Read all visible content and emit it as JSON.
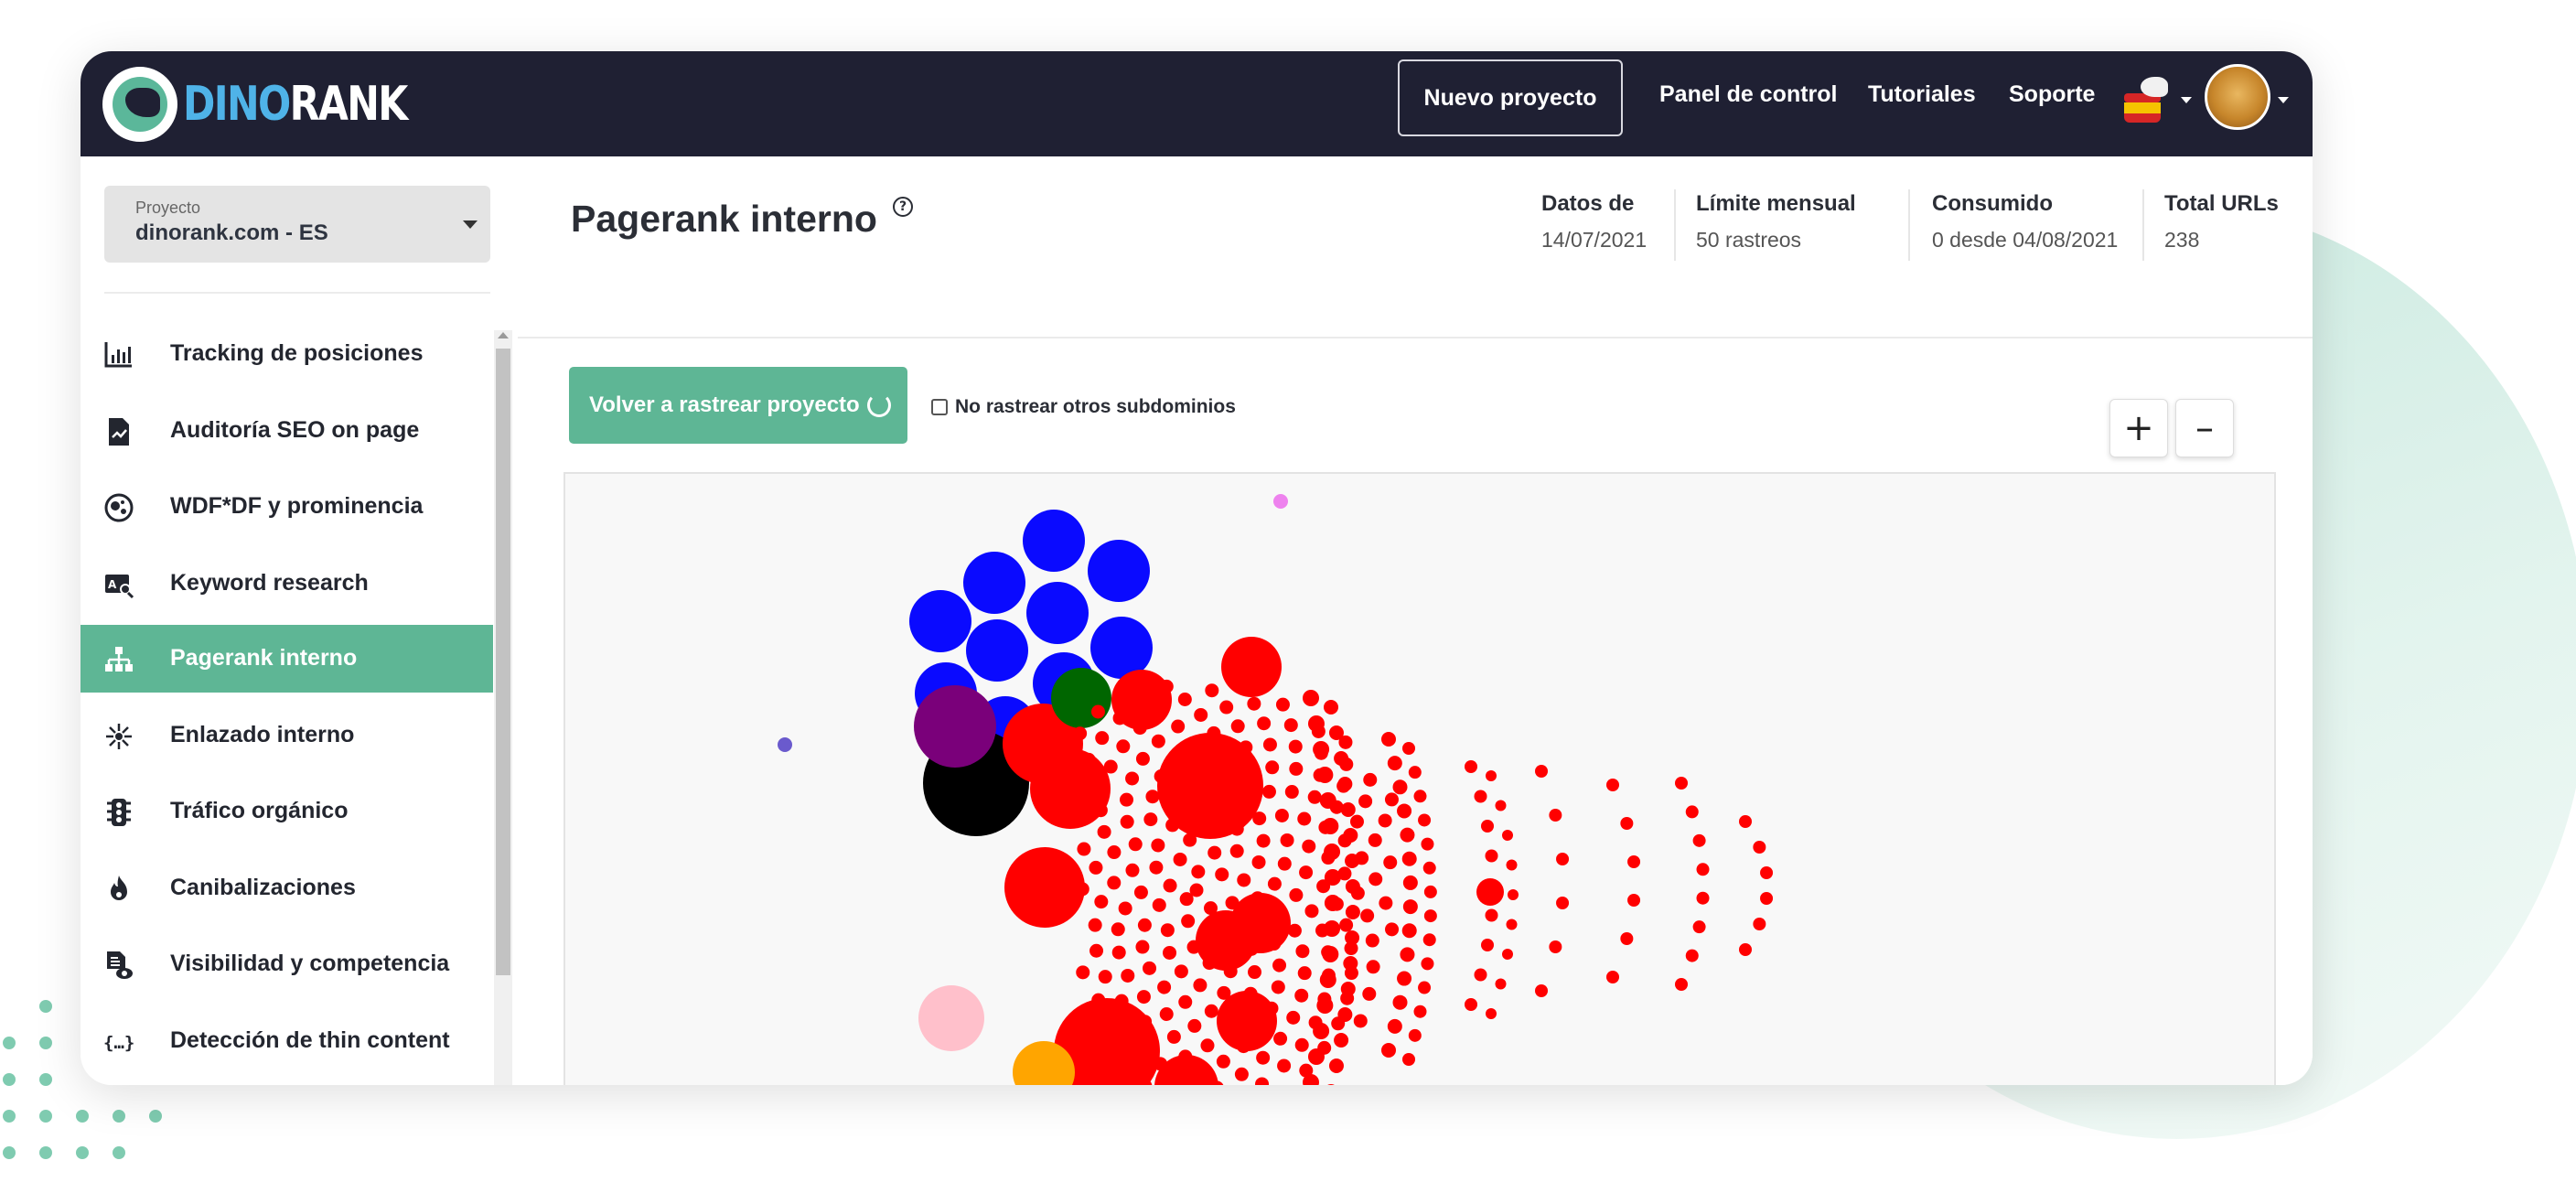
{
  "brand": {
    "logo_part1": "DINO",
    "logo_part2": "RANK",
    "accent": "#5eb695",
    "topbar": "#1f2033"
  },
  "topnav": {
    "new_project": "Nuevo proyecto",
    "links": [
      "Panel de control",
      "Tutoriales",
      "Soporte"
    ],
    "language_icon": "spain-flag-icon",
    "avatar_icon": "user-avatar"
  },
  "project": {
    "label": "Proyecto",
    "value": "dinorank.com - ES"
  },
  "sidebar": {
    "items": [
      {
        "label": "Tracking de posiciones",
        "icon": "bar-chart-icon"
      },
      {
        "label": "Auditoría SEO on page",
        "icon": "document-chart-icon"
      },
      {
        "label": "WDF*DF y prominencia",
        "icon": "bubbles-icon"
      },
      {
        "label": "Keyword research",
        "icon": "keyword-search-icon"
      },
      {
        "label": "Pagerank interno",
        "icon": "sitemap-icon",
        "active": true
      },
      {
        "label": "Enlazado interno",
        "icon": "network-icon"
      },
      {
        "label": "Tráfico orgánico",
        "icon": "traffic-light-icon"
      },
      {
        "label": "Canibalizaciones",
        "icon": "fire-icon"
      },
      {
        "label": "Visibilidad y competencia",
        "icon": "document-eye-icon"
      },
      {
        "label": "Detección de thin content",
        "icon": "code-braces-icon"
      }
    ]
  },
  "page": {
    "title": "Pagerank interno"
  },
  "stats": [
    {
      "label": "Datos de",
      "value": "14/07/2021"
    },
    {
      "label": "Límite mensual",
      "value": "50 rastreos"
    },
    {
      "label": "Consumido",
      "value": "0 desde 04/08/2021"
    },
    {
      "label": "Total URLs",
      "value": "238"
    }
  ],
  "actions": {
    "recrawl": "Volver a rastrear proyecto",
    "no_subdomains": "No rastrear otros subdominios",
    "zoom_in": "+",
    "zoom_out": "–"
  },
  "colors": {
    "blue": "#0a0aff",
    "red": "#ff0000",
    "green": "#006600",
    "purple": "#7a007a",
    "black": "#000000",
    "pink": "#ffc0cb",
    "orange": "#ffa500",
    "olive": "#bdb76b",
    "violet": "#ee82ee",
    "slate": "#6a5acd"
  }
}
